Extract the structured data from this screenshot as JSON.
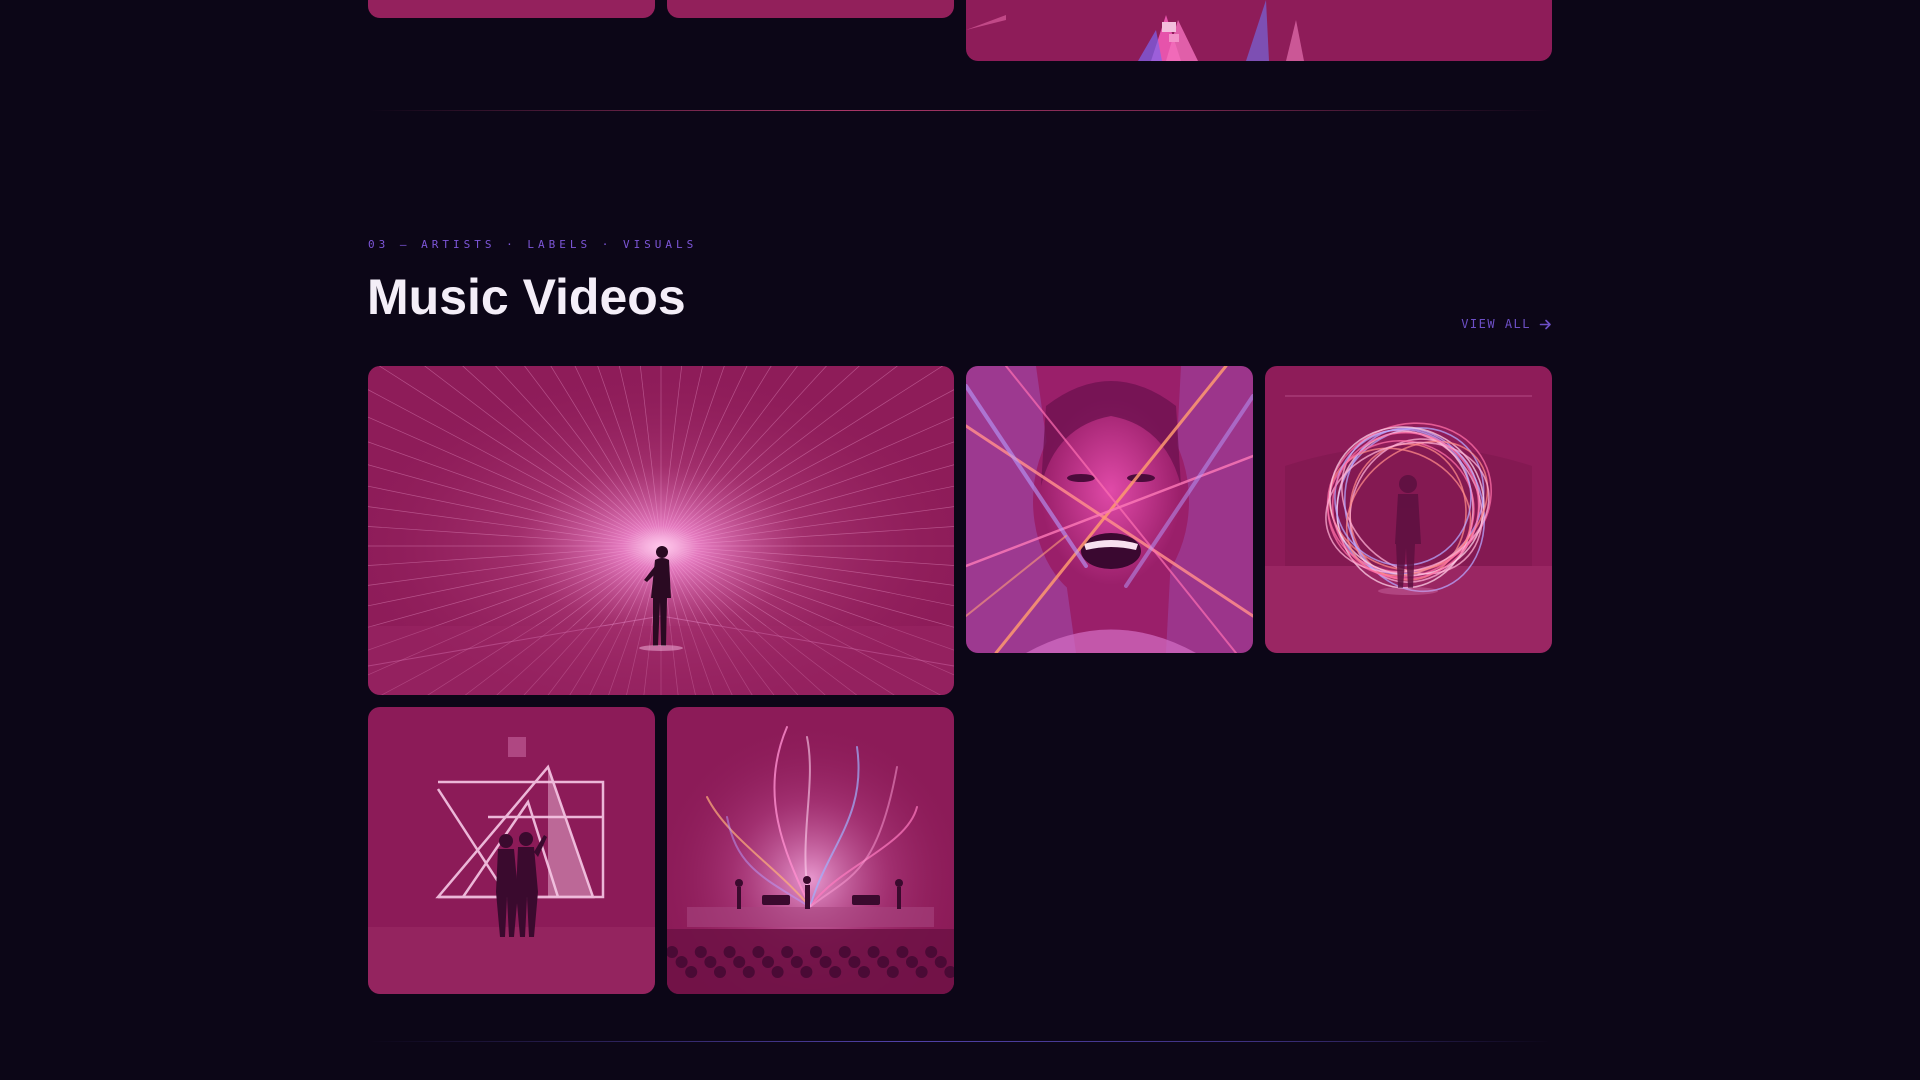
{
  "section": {
    "eyebrow": "03 — ARTISTS · LABELS · VISUALS",
    "title": "Music Videos",
    "view_all_label": "VIEW ALL",
    "view_all_icon": "arrow-right-icon"
  },
  "colors": {
    "background": "#0c0617",
    "accent_pink": "#de4682",
    "accent_violet": "#7d56d8",
    "title": "#f4eef8",
    "thumbnail_tint": "#8e1e5c"
  },
  "videos": [
    {
      "scene": "performer-in-light-burst"
    },
    {
      "scene": "singer-face-with-laser-beams"
    },
    {
      "scene": "figure-in-light-rings"
    },
    {
      "scene": "duo-in-neon-geometric-frame"
    },
    {
      "scene": "band-on-stage-with-light-ribbons"
    }
  ],
  "previous_section": {
    "videos": [
      {
        "scene": "cropped-thumbnail"
      },
      {
        "scene": "cropped-thumbnail"
      },
      {
        "scene": "cropped-neon-thumbnail"
      }
    ]
  }
}
